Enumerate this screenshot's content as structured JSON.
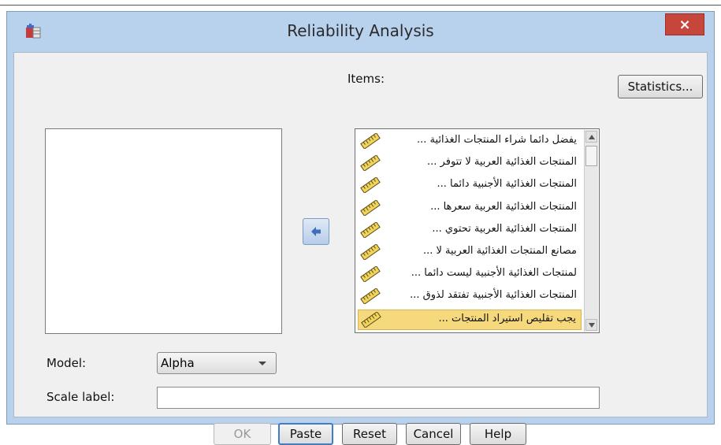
{
  "window": {
    "title": "Reliability Analysis",
    "close_glyph": "×"
  },
  "labels": {
    "items": "Items:",
    "model": "Model:",
    "scale_label": "Scale label:"
  },
  "items": [
    {
      "label": "يفضل دائما شراء المنتجات الغذائية ...",
      "selected": false
    },
    {
      "label": "المنتجات الغذائية العربية لا تتوفر ...",
      "selected": false
    },
    {
      "label": "المنتجات الغذائية الأجنبية دائما ...",
      "selected": false
    },
    {
      "label": "المنتجات الغذائية العربية سعرها ...",
      "selected": false
    },
    {
      "label": "المنتجات الغذائية العربية تحتوي ...",
      "selected": false
    },
    {
      "label": "مصانع المنتجات الغذائية العربية لا ...",
      "selected": false
    },
    {
      "label": "لمنتجات الغذائية الأجنبية ليست دائما ...",
      "selected": false
    },
    {
      "label": "المنتجات الغذائية الأجنبية تفتقد لذوق ...",
      "selected": false
    },
    {
      "label": "يجب تقليص استيراد المنتجات ...",
      "selected": true
    }
  ],
  "model": {
    "value": "Alpha"
  },
  "scale_label": {
    "value": ""
  },
  "buttons": {
    "statistics": "Statistics...",
    "ok": "OK",
    "paste": "Paste",
    "reset": "Reset",
    "cancel": "Cancel",
    "help": "Help"
  },
  "icons": {
    "app": "spss-app-icon",
    "move": "left-arrow-icon",
    "item": "ruler-scale-icon"
  },
  "colors": {
    "title_bg": "#b8d2ee",
    "close_bg": "#c7463b",
    "selected_item": "#f7d97d",
    "arrow_blue": "#3f6fb8"
  }
}
